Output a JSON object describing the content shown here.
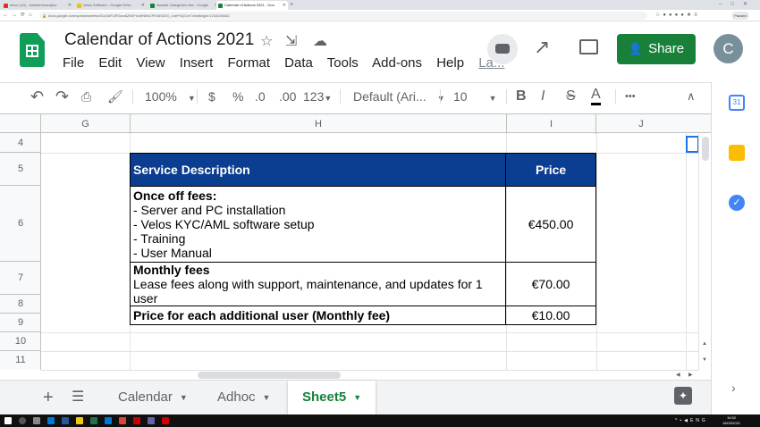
{
  "browser": {
    "tabs": [
      {
        "label": "Inbox (10) - shimberimou@sc",
        "color": "#d93025"
      },
      {
        "label": "Velos Software - Google Drive",
        "color": "#fbbc04"
      },
      {
        "label": "Awards Categories.xlsx - Google",
        "color": "#188038"
      },
      {
        "label": "Calendar of Actions 2021 - Goo",
        "color": "#188038",
        "active": true
      }
    ],
    "url": "docs.google.com/spreadsheets/d/1cOdFURGwo6ZKbFmJflNBhCFK06S25X_LbePnQCmT4/edit#gid=1216226482",
    "profile_status": "Paused"
  },
  "doc": {
    "title": "Calendar of Actions 2021",
    "menu": [
      "File",
      "Edit",
      "View",
      "Insert",
      "Format",
      "Data",
      "Tools",
      "Add-ons",
      "Help"
    ],
    "last_edit_label": "La...",
    "share_label": "Share",
    "avatar_initial": "C"
  },
  "toolbar": {
    "zoom": "100%",
    "currency": "$",
    "percent": "%",
    "decrease_decimal": ".0",
    "increase_decimal": ".00",
    "more_formats": "123",
    "font": "Default (Ari...",
    "font_size": "10",
    "bold": "B",
    "italic": "I",
    "strike": "S",
    "text_color": "A",
    "more": "•••"
  },
  "sheet": {
    "columns": [
      "G",
      "H",
      "I",
      "J"
    ],
    "rows": [
      "4",
      "5",
      "6",
      "7",
      "8",
      "9",
      "10",
      "11"
    ],
    "table": {
      "header": {
        "service": "Service Description",
        "price": "Price"
      },
      "once_off": {
        "title": "Once off fees:",
        "items": [
          " - Server and PC installation",
          " - Velos KYC/AML software setup",
          " - Training",
          " - User Manual"
        ],
        "price": "€450.00"
      },
      "monthly": {
        "title": "Monthly fees",
        "detail": "Lease fees along with support, maintenance, and updates for 1 user",
        "price": "€70.00"
      },
      "additional": {
        "title": "Price for each additional user (Monthly fee)",
        "price": "€10.00"
      }
    }
  },
  "sheet_tabs": [
    {
      "label": "Calendar"
    },
    {
      "label": "Adhoc"
    },
    {
      "label": "Sheet5",
      "active": true
    }
  ],
  "taskbar": {
    "language": "ENG",
    "time": "16:52",
    "date": "18/03/2021"
  },
  "colors": {
    "header_fill": "#0b3d91",
    "share_green": "#188038",
    "selection_blue": "#1a73e8"
  }
}
